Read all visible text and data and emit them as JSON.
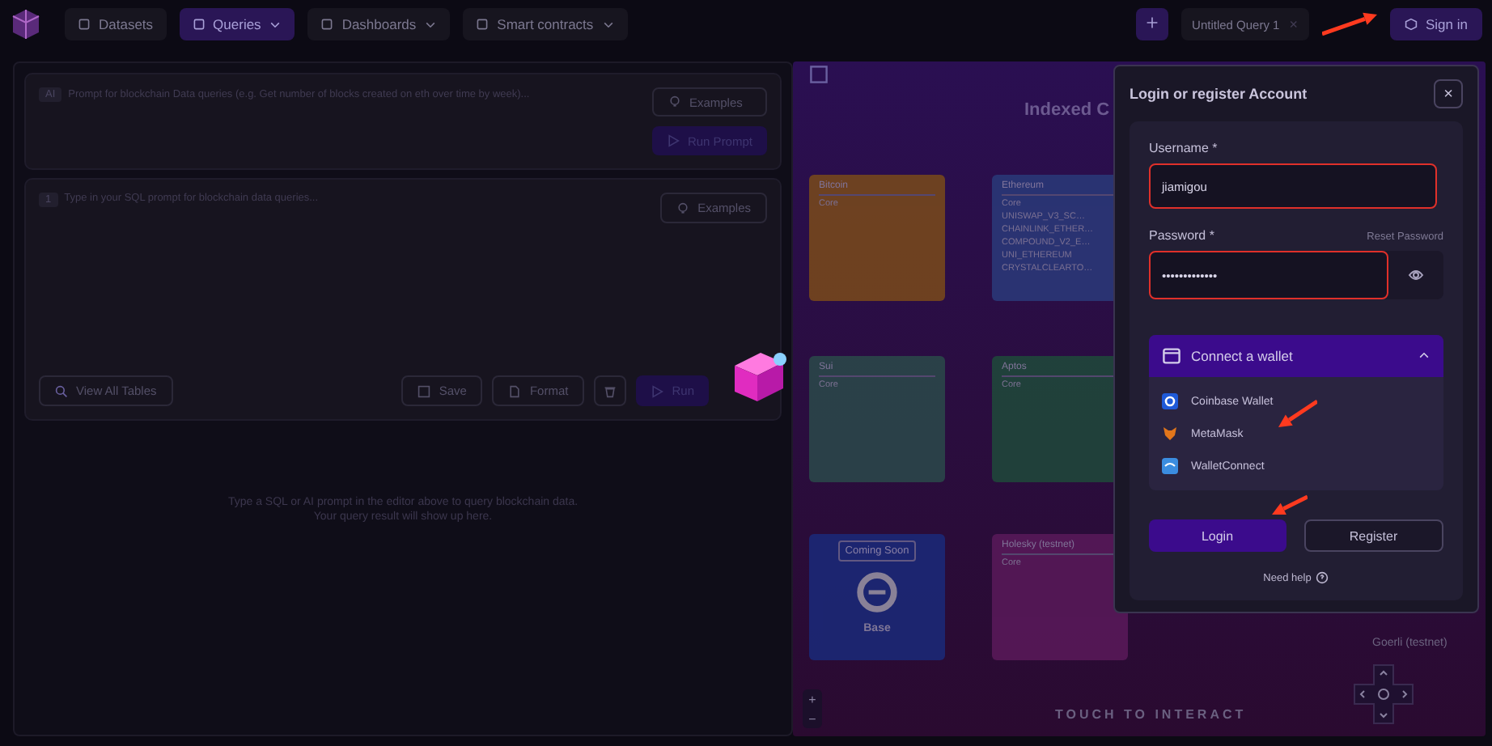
{
  "nav": {
    "items": [
      {
        "label": "Datasets",
        "selected": false,
        "caret": false
      },
      {
        "label": "Queries",
        "selected": true,
        "caret": true
      },
      {
        "label": "Dashboards",
        "selected": false,
        "caret": true
      },
      {
        "label": "Smart contracts",
        "selected": false,
        "caret": true
      }
    ],
    "query_tab": {
      "label": "Untitled Query 1",
      "close": "×"
    },
    "sign_in": {
      "label": "Sign in",
      "arrow": true
    }
  },
  "ai_prompt": {
    "badge": "AI",
    "placeholder": "Prompt for blockchain Data queries (e.g. Get number of blocks created on eth over time by week)...",
    "examples": "Examples",
    "run": "Run Prompt"
  },
  "sql_editor": {
    "line_number": "1",
    "placeholder": "Type in your SQL prompt for blockchain data queries...",
    "examples": "Examples",
    "view_tables": "View All Tables",
    "save": "Save",
    "format": "Format",
    "run": "Run"
  },
  "results": {
    "empty_lines": [
      "Type a SQL or AI prompt in the editor above to query blockchain data.",
      "Your query result will show up here."
    ]
  },
  "canvas": {
    "title": "Indexed C",
    "chains": [
      {
        "name": "Bitcoin",
        "kind": "list",
        "color": "#7a4a1a",
        "items": [
          "Core"
        ]
      },
      {
        "name": "Ethereum",
        "kind": "list",
        "color": "#2a3a7a",
        "items": [
          "Core",
          "UNISWAP_V3_SC…",
          "CHAINLINK_ETHER…",
          "COMPOUND_V2_E…",
          "UNI_ETHEREUM",
          "CRYSTALCLEARTO…"
        ]
      },
      {
        "name": "Sui",
        "kind": "list",
        "color": "#2a4a4a",
        "items": [
          "Core"
        ]
      },
      {
        "name": "Aptos",
        "kind": "list",
        "color": "#1f4a3a",
        "items": [
          "Core"
        ]
      },
      {
        "name": "Base",
        "kind": "coming_soon",
        "color": "#1a2a7a",
        "badge": "Coming Soon"
      },
      {
        "name": "Holesky (testnet)",
        "kind": "list",
        "color": "#5a1a5a",
        "items": [
          "Core"
        ]
      }
    ],
    "goerli": "Goerli (testnet)",
    "hint": "TOUCH TO INTERACT",
    "zoom_in": "+",
    "zoom_out": "−"
  },
  "dialog": {
    "title": "Login or register Account",
    "close": "×",
    "username": {
      "label": "Username *",
      "value": "jiamigou",
      "highlighted": true
    },
    "password": {
      "label": "Password *",
      "value": "•••••••••••••",
      "reset": "Reset Password",
      "highlighted": true
    },
    "wallet": {
      "title": "Connect a wallet",
      "expanded": true,
      "options": [
        {
          "name": "Coinbase Wallet",
          "kind": "coinbase",
          "arrow": false
        },
        {
          "name": "MetaMask",
          "kind": "metamask",
          "arrow": true
        },
        {
          "name": "WalletConnect",
          "kind": "walletconnect",
          "arrow": false
        }
      ]
    },
    "login": {
      "label": "Login",
      "arrow": true
    },
    "register": "Register",
    "help": "Need help"
  }
}
